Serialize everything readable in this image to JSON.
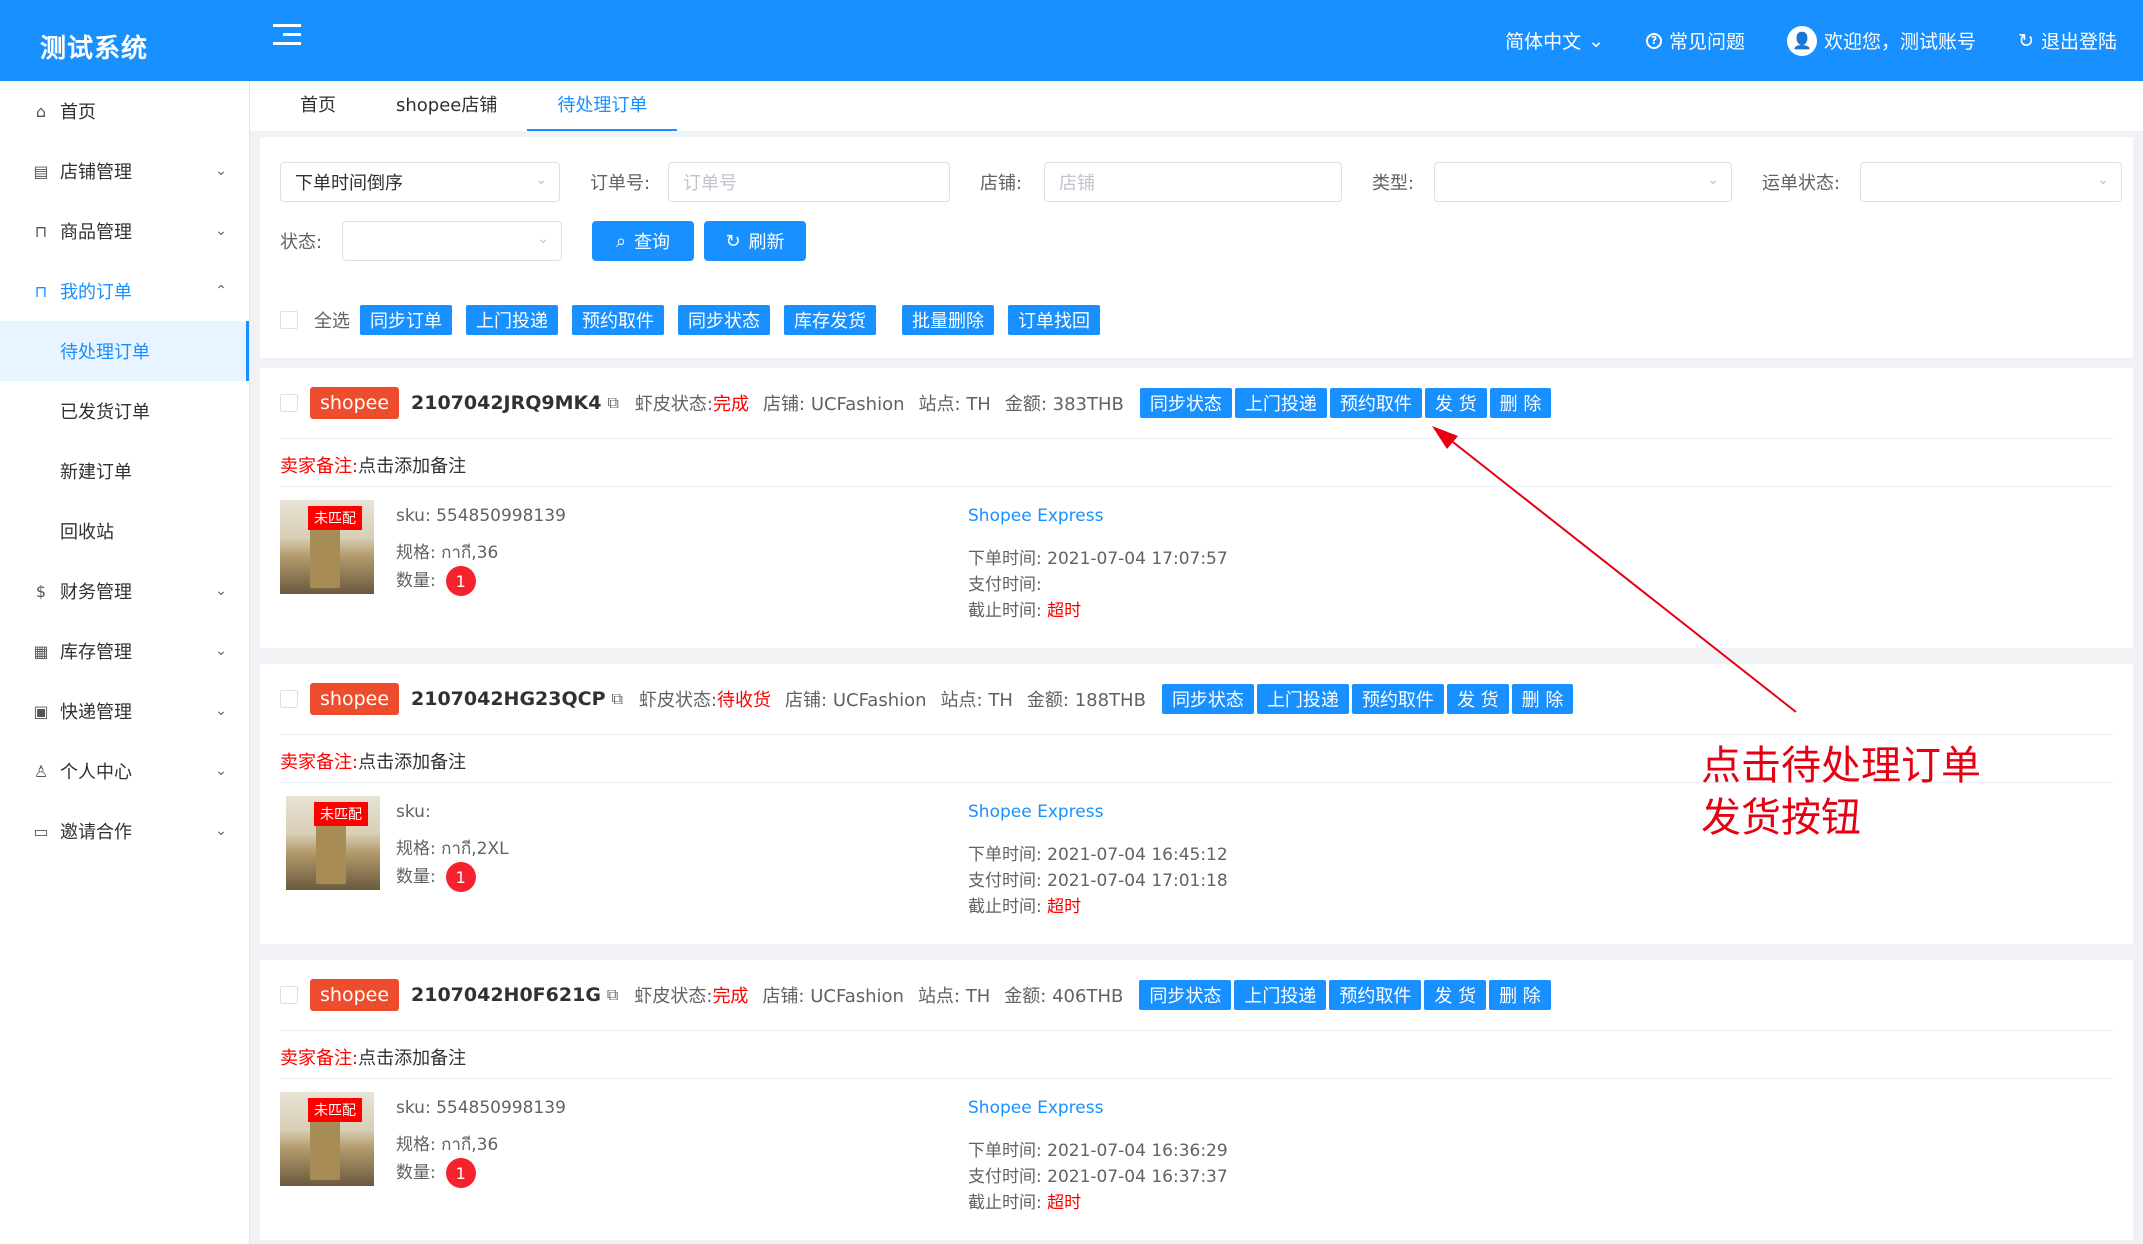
{
  "app": {
    "title": "测试系统"
  },
  "header": {
    "lang": "简体中文",
    "faq": "常见问题",
    "welcome": "欢迎您，测试账号",
    "logout": "退出登陆"
  },
  "sidebar": {
    "items": [
      {
        "label": "首页",
        "icon": "home-icon"
      },
      {
        "label": "店铺管理",
        "icon": "shop-icon"
      },
      {
        "label": "商品管理",
        "icon": "bag-icon"
      },
      {
        "label": "我的订单",
        "icon": "order-icon"
      },
      {
        "label": "财务管理",
        "icon": "finance-icon"
      },
      {
        "label": "库存管理",
        "icon": "stock-icon"
      },
      {
        "label": "快递管理",
        "icon": "express-icon"
      },
      {
        "label": "个人中心",
        "icon": "user-icon"
      },
      {
        "label": "邀请合作",
        "icon": "invite-icon"
      }
    ],
    "order_sub": [
      "待处理订单",
      "已发货订单",
      "新建订单",
      "回收站"
    ]
  },
  "tabs": [
    "首页",
    "shopee店铺",
    "待处理订单"
  ],
  "filters": {
    "sort_value": "下单时间倒序",
    "order_no_label": "订单号:",
    "order_no_placeholder": "订单号",
    "shop_label": "店铺:",
    "shop_placeholder": "店铺",
    "type_label": "类型:",
    "waybill_label": "运单状态:",
    "status_label": "状态:",
    "query_btn": "查询",
    "refresh_btn": "刷新"
  },
  "bulk": {
    "select_all": "全选",
    "actions": [
      "同步订单",
      "上门投递",
      "预约取件",
      "同步状态",
      "库存发货",
      "批量删除",
      "订单找回"
    ]
  },
  "order_actions": [
    "同步状态",
    "上门投递",
    "预约取件",
    "发 货",
    "删 除"
  ],
  "common": {
    "platform": "shopee",
    "shrimp_status_label": "虾皮状态:",
    "shop_label": "店铺:",
    "site_label": "站点:",
    "amount_label": "金额:",
    "remark_label": "卖家备注:",
    "remark_value": "点击添加备注",
    "unmatched": "未匹配",
    "sku_label": "sku:",
    "spec_label": "规格:",
    "qty_label": "数量:",
    "order_time_label": "下单时间:",
    "pay_time_label": "支付时间:",
    "deadline_label": "截止时间:",
    "overtime": "超时"
  },
  "orders": [
    {
      "order_no": "2107042JRQ9MK4",
      "shrimp_status": "完成",
      "shop": "UCFashion",
      "site": "TH",
      "amount": "383THB",
      "sku": "554850998139",
      "spec": "กากี,36",
      "qty": "1",
      "express": "Shopee Express",
      "order_time": "2021-07-04 17:07:57",
      "pay_time": ""
    },
    {
      "order_no": "2107042HG23QCP",
      "shrimp_status": "待收货",
      "shop": "UCFashion",
      "site": "TH",
      "amount": "188THB",
      "sku": "",
      "spec": "กากี,2XL",
      "qty": "1",
      "express": "Shopee Express",
      "order_time": "2021-07-04 16:45:12",
      "pay_time": "2021-07-04 17:01:18"
    },
    {
      "order_no": "2107042H0F621G",
      "shrimp_status": "完成",
      "shop": "UCFashion",
      "site": "TH",
      "amount": "406THB",
      "sku": "554850998139",
      "spec": "กากี,36",
      "qty": "1",
      "express": "Shopee Express",
      "order_time": "2021-07-04 16:36:29",
      "pay_time": "2021-07-04 16:37:37"
    }
  ],
  "annotation": {
    "line1": "点击待处理订单",
    "line2": "发货按钮",
    "color": "#e60012"
  }
}
